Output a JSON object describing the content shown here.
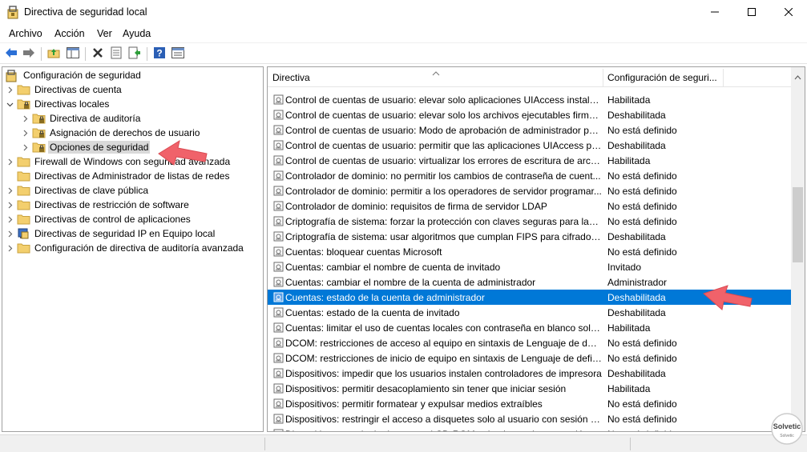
{
  "window": {
    "title": "Directiva de seguridad local",
    "minimize_icon": "minimize-icon",
    "maximize_icon": "maximize-icon",
    "close_icon": "close-icon"
  },
  "menu": {
    "items": [
      "Archivo",
      "Acción",
      "Ver",
      "Ayuda"
    ]
  },
  "toolbar": {
    "buttons": [
      "back-icon",
      "forward-icon",
      "up-folder-icon",
      "show-tree-icon",
      "delete-icon",
      "properties-icon",
      "export-list-icon",
      "help-icon",
      "console-view-icon"
    ]
  },
  "tree": {
    "root": "Configuración de seguridad",
    "items": [
      {
        "label": "Directivas de cuenta",
        "level": 1,
        "expanded": false
      },
      {
        "label": "Directivas locales",
        "level": 1,
        "expanded": true
      },
      {
        "label": "Directiva de auditoría",
        "level": 2,
        "expanded": false
      },
      {
        "label": "Asignación de derechos de usuario",
        "level": 2,
        "expanded": false
      },
      {
        "label": "Opciones de seguridad",
        "level": 2,
        "expanded": false,
        "selected": true
      },
      {
        "label": "Firewall de Windows con seguridad avanzada",
        "level": 1,
        "expanded": false
      },
      {
        "label": "Directivas de Administrador de listas de redes",
        "level": 1,
        "expanded": false
      },
      {
        "label": "Directivas de clave pública",
        "level": 1,
        "expanded": false
      },
      {
        "label": "Directivas de restricción de software",
        "level": 1,
        "expanded": false
      },
      {
        "label": "Directivas de control de aplicaciones",
        "level": 1,
        "expanded": false
      },
      {
        "label": "Directivas de seguridad IP en Equipo local",
        "level": 1,
        "expanded": false
      },
      {
        "label": "Configuración de directiva de auditoría avanzada",
        "level": 1,
        "expanded": false
      }
    ]
  },
  "list": {
    "columns": [
      "Directiva",
      "Configuración de seguri..."
    ],
    "rows": [
      {
        "policy": "Control de cuentas de usuario: elevar solo aplicaciones UIAccess instalad...",
        "setting": "Habilitada"
      },
      {
        "policy": "Control de cuentas de usuario: elevar solo los archivos ejecutables firmad...",
        "setting": "Deshabilitada"
      },
      {
        "policy": "Control de cuentas de usuario: Modo de aprobación de administrador pa...",
        "setting": "No está definido"
      },
      {
        "policy": "Control de cuentas de usuario: permitir que las aplicaciones UIAccess pid...",
        "setting": "Deshabilitada"
      },
      {
        "policy": "Control de cuentas de usuario: virtualizar los errores de escritura de archi...",
        "setting": "Habilitada"
      },
      {
        "policy": "Controlador de dominio: no permitir los cambios de contraseña de cuent...",
        "setting": "No está definido"
      },
      {
        "policy": "Controlador de dominio: permitir a los operadores de servidor programar...",
        "setting": "No está definido"
      },
      {
        "policy": "Controlador de dominio: requisitos de firma de servidor LDAP",
        "setting": "No está definido"
      },
      {
        "policy": "Criptografía de sistema: forzar la protección con claves seguras para las c...",
        "setting": "No está definido"
      },
      {
        "policy": "Criptografía de sistema: usar algoritmos que cumplan FIPS para cifrado, f...",
        "setting": "Deshabilitada"
      },
      {
        "policy": "Cuentas: bloquear cuentas Microsoft",
        "setting": "No está definido"
      },
      {
        "policy": "Cuentas: cambiar el nombre de cuenta de invitado",
        "setting": "Invitado"
      },
      {
        "policy": "Cuentas: cambiar el nombre de la cuenta de administrador",
        "setting": "Administrador"
      },
      {
        "policy": "Cuentas: estado de la cuenta de administrador",
        "setting": "Deshabilitada",
        "selected": true
      },
      {
        "policy": "Cuentas: estado de la cuenta de invitado",
        "setting": "Deshabilitada"
      },
      {
        "policy": "Cuentas: limitar el uso de cuentas locales con contraseña en blanco solo ...",
        "setting": "Habilitada"
      },
      {
        "policy": "DCOM: restricciones de acceso al equipo en sintaxis de Lenguaje de defin...",
        "setting": "No está definido"
      },
      {
        "policy": "DCOM: restricciones de inicio de equipo en sintaxis de Lenguaje de defini...",
        "setting": "No está definido"
      },
      {
        "policy": "Dispositivos: impedir que los usuarios instalen controladores de impresora",
        "setting": "Deshabilitada"
      },
      {
        "policy": "Dispositivos: permitir desacoplamiento sin tener que iniciar sesión",
        "setting": "Habilitada"
      },
      {
        "policy": "Dispositivos: permitir formatear y expulsar medios extraíbles",
        "setting": "No está definido"
      },
      {
        "policy": "Dispositivos: restringir el acceso a disquetes solo al usuario con sesión ini...",
        "setting": "No está definido"
      },
      {
        "policy": "Dispositivos: restringir el acceso al CD-ROM solo al usuario con sesión ini...",
        "setting": "No está definido"
      }
    ]
  },
  "colors": {
    "selection": "#0078d7",
    "tree_selection": "#d9d9d9",
    "annotation_arrow": "#f0626a",
    "folder": "#f3cf6e"
  }
}
